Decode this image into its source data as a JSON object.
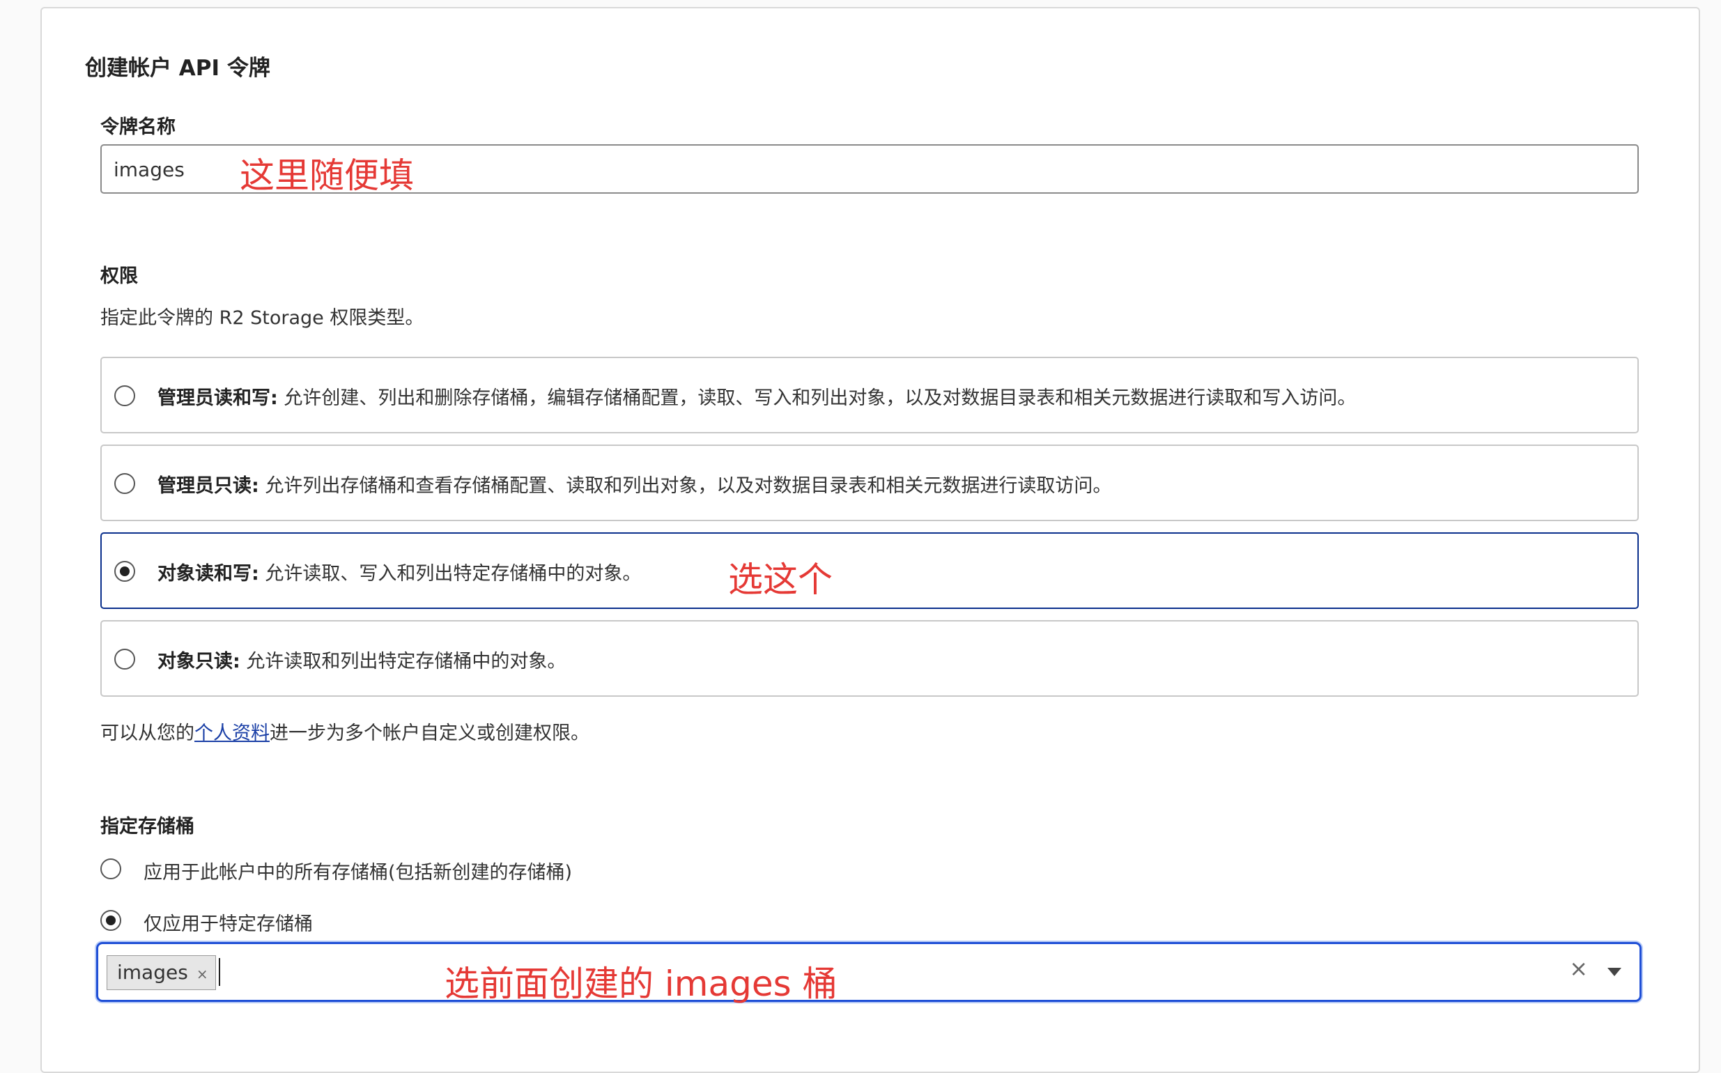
{
  "page": {
    "title": "创建帐户 API 令牌"
  },
  "token_name": {
    "label": "令牌名称",
    "value": "images",
    "annotation": "这里随便填"
  },
  "permissions": {
    "label": "权限",
    "description": "指定此令牌的 R2 Storage 权限类型。",
    "options": [
      {
        "title": "管理员读和写:",
        "desc": "允许创建、列出和删除存储桶，编辑存储桶配置，读取、写入和列出对象，以及对数据目录表和相关元数据进行读取和写入访问。",
        "selected": false
      },
      {
        "title": "管理员只读:",
        "desc": "允许列出存储桶和查看存储桶配置、读取和列出对象，以及对数据目录表和相关元数据进行读取访问。",
        "selected": false
      },
      {
        "title": "对象读和写:",
        "desc": "允许读取、写入和列出特定存储桶中的对象。",
        "selected": true
      },
      {
        "title": "对象只读:",
        "desc": "允许读取和列出特定存储桶中的对象。",
        "selected": false
      }
    ],
    "selected_annotation": "选这个",
    "footer_prefix": "可以从您的",
    "footer_link": "个人资料",
    "footer_suffix": "进一步为多个帐户自定义或创建权限。"
  },
  "buckets": {
    "label": "指定存储桶",
    "options": [
      {
        "label": "应用于此帐户中的所有存储桶(包括新创建的存储桶)",
        "selected": false
      },
      {
        "label": "仅应用于特定存储桶",
        "selected": true
      }
    ],
    "selected_tags": [
      "images"
    ],
    "tag_remove_glyph": "×",
    "clear_glyph": "×",
    "annotation": "选前面创建的 images 桶"
  },
  "colors": {
    "annotation": "#e53935",
    "selected_border": "#0a2f8c",
    "focus_border": "#1f4fd6",
    "link": "#1a3fa6"
  }
}
